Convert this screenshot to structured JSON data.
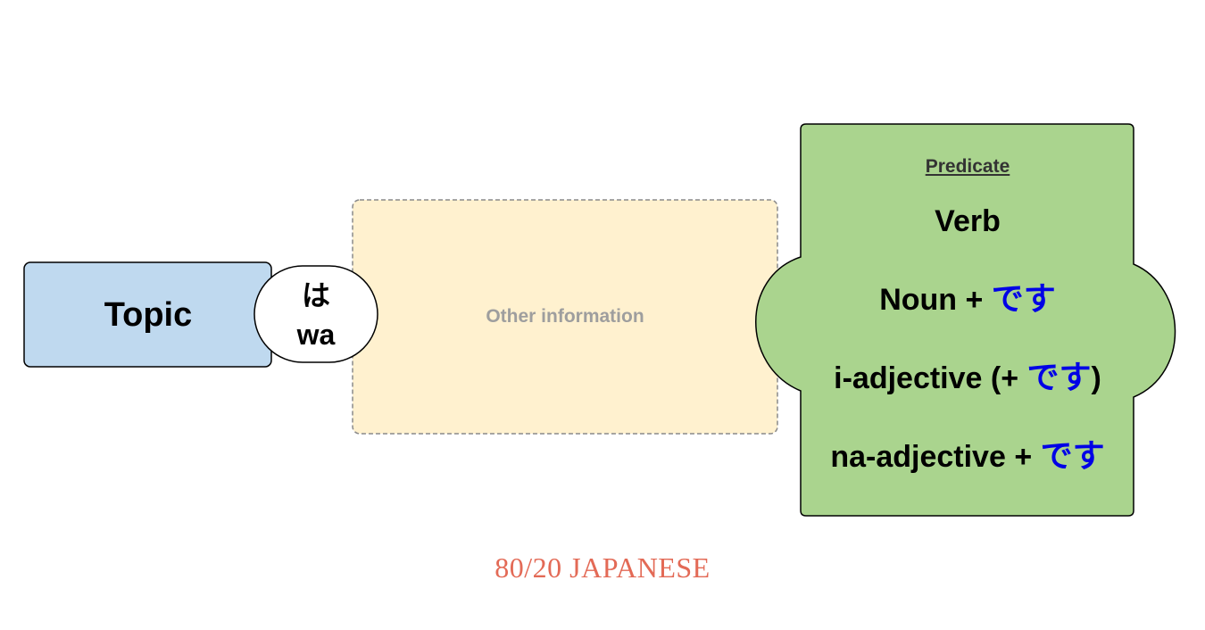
{
  "topic": {
    "label": "Topic",
    "fill": "#bfd9ef"
  },
  "particle": {
    "kana": "は",
    "romaji": "wa",
    "fill": "#ffffff"
  },
  "other": {
    "label": "Other information",
    "fill": "#fff1cf",
    "text_color": "#9e9e9e"
  },
  "predicate": {
    "heading": "Predicate",
    "fill": "#aad48e",
    "desu_color": "#0000e6",
    "lines": {
      "verb": "Verb",
      "noun": "Noun + ",
      "noun_desu": "です",
      "iadj_before": "i-adjective (+ ",
      "iadj_desu": "です",
      "iadj_after": ")",
      "naadj": "na-adjective + ",
      "naadj_desu": "です"
    }
  },
  "brand": {
    "text": "80/20 JAPANESE",
    "color": "#e36a56"
  }
}
